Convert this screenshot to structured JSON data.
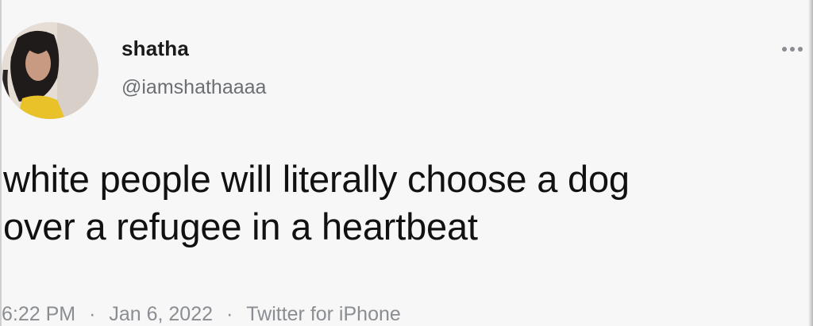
{
  "user": {
    "display_name": "shatha",
    "handle": "@iamshathaaaa"
  },
  "tweet": {
    "text_line1": "white people will literally choose a dog",
    "text_line2": "over a refugee in a heartbeat"
  },
  "meta": {
    "time": "6:22 PM",
    "separator": "·",
    "date": "Jan 6, 2022",
    "source": "Twitter for iPhone"
  },
  "icons": {
    "avatar": "profile-photo",
    "more": "more-options-icon"
  },
  "colors": {
    "background": "#f7f7f7",
    "text": "#111111",
    "secondary": "#6b6f74"
  }
}
